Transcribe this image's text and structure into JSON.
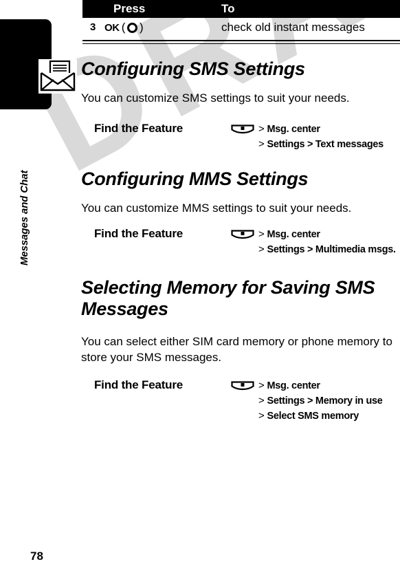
{
  "document": {
    "watermark": "DRAFT",
    "page_number": "78",
    "chapter_label": "Messages and Chat",
    "chapter_icon": "envelope-letter-icon"
  },
  "table": {
    "headers": {
      "press": "Press",
      "to": "To"
    },
    "rows": [
      {
        "step": "3",
        "key_label": "OK",
        "key_icon": "navigation-key-icon",
        "paren_open": "(",
        "paren_close": ")",
        "description": "check old instant messages"
      }
    ]
  },
  "sections": [
    {
      "title": "Configuring SMS Settings",
      "body": "You can customize SMS settings to suit your needs.",
      "find_the_feature": {
        "label": "Find the Feature",
        "icon": "menu-key-icon",
        "lines": [
          {
            "gt": ">",
            "text": "Msg. center"
          },
          {
            "gt": ">",
            "text": "Settings >  Text messages"
          }
        ]
      }
    },
    {
      "title": "Configuring MMS Settings",
      "body": "You can customize MMS settings to suit your needs.",
      "find_the_feature": {
        "label": "Find the Feature",
        "icon": "menu-key-icon",
        "lines": [
          {
            "gt": ">",
            "text": "Msg. center"
          },
          {
            "gt": ">",
            "text": "Settings >  Multimedia msgs."
          }
        ]
      }
    },
    {
      "title": "Selecting Memory for Saving SMS Messages",
      "body": "You can select either SIM card memory or phone memory to store your SMS messages.",
      "find_the_feature": {
        "label": "Find the Feature",
        "icon": "menu-key-icon",
        "lines": [
          {
            "gt": ">",
            "text": "Msg. center"
          },
          {
            "gt": ">",
            "text": "Settings >  Memory in use"
          },
          {
            "gt": ">",
            "text": "Select SMS memory"
          }
        ]
      }
    }
  ],
  "colors": {
    "ink": "#000000",
    "paper": "#ffffff",
    "watermark": "#d9d9d9"
  }
}
